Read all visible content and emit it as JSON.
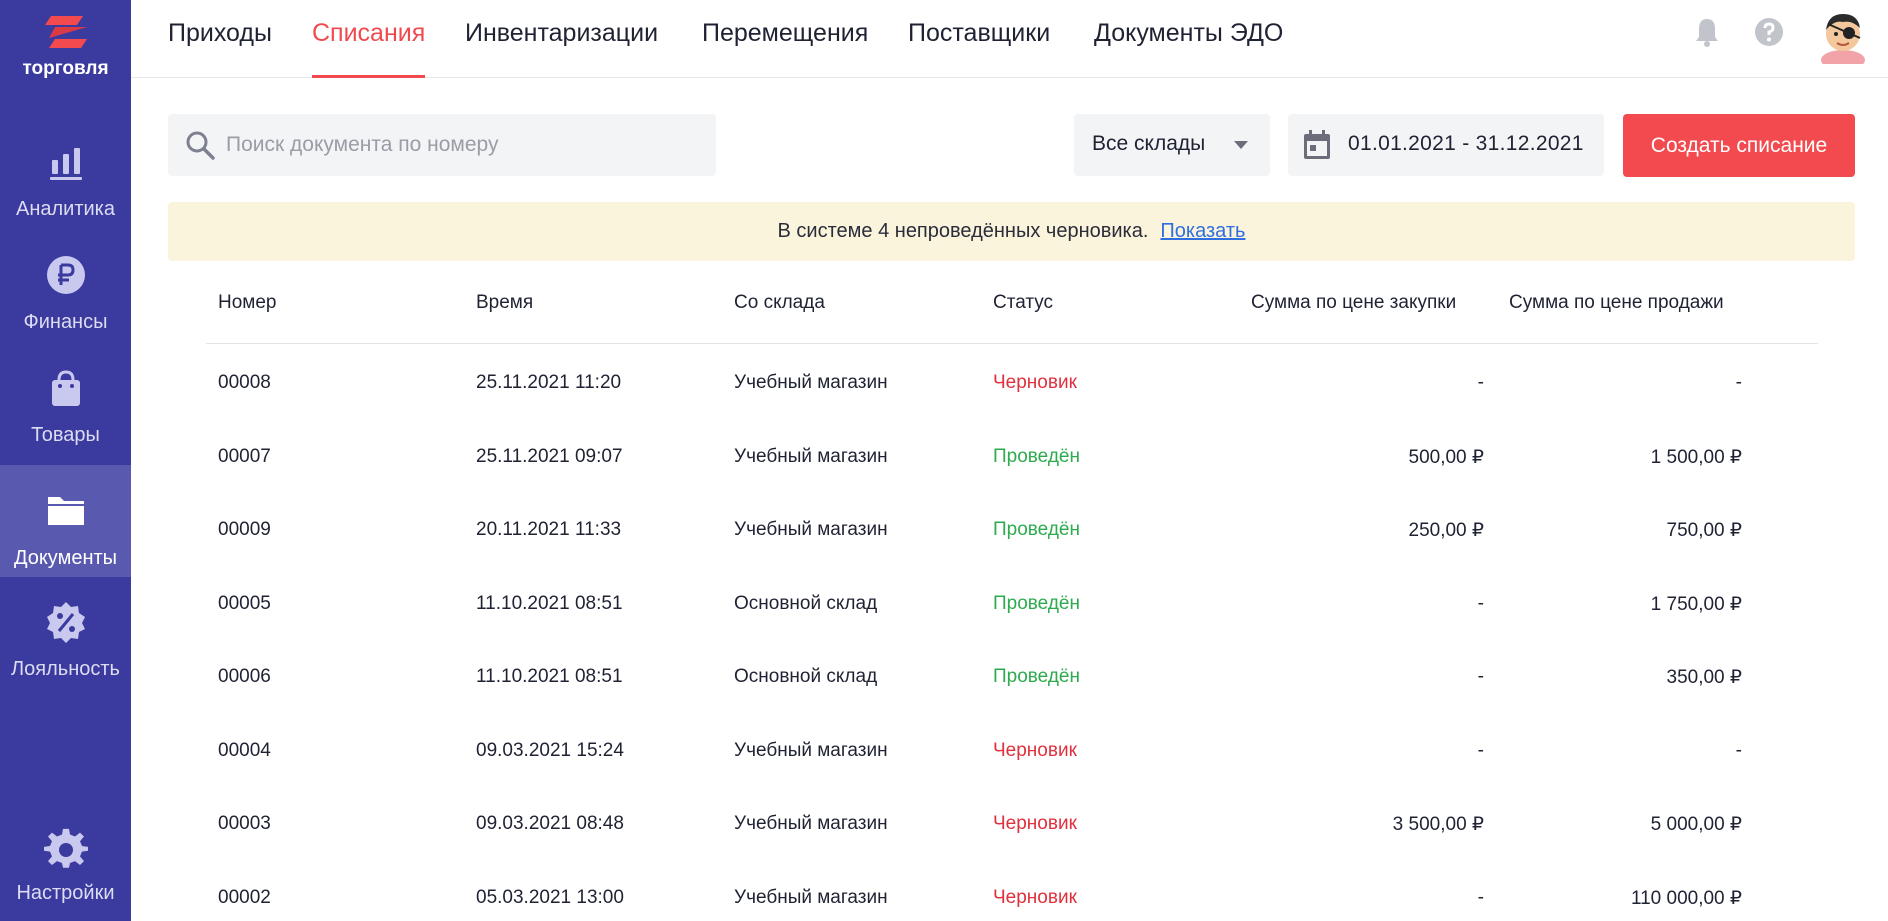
{
  "app": {
    "logo_text": "торговля"
  },
  "sidebar": {
    "items": [
      {
        "label": "Аналитика",
        "icon": "chart-bars-icon"
      },
      {
        "label": "Финансы",
        "icon": "ruble-icon"
      },
      {
        "label": "Товары",
        "icon": "shopping-bag-icon"
      },
      {
        "label": "Документы",
        "icon": "folder-icon",
        "active": true
      },
      {
        "label": "Лояльность",
        "icon": "discount-badge-icon"
      },
      {
        "label": "Настройки",
        "icon": "gear-icon"
      }
    ]
  },
  "tabs": [
    {
      "label": "Приходы"
    },
    {
      "label": "Списания",
      "active": true
    },
    {
      "label": "Инвентаризации"
    },
    {
      "label": "Перемещения"
    },
    {
      "label": "Поставщики"
    },
    {
      "label": "Документы ЭДО"
    }
  ],
  "toolbar": {
    "search_placeholder": "Поиск документа по номеру",
    "search_value": "",
    "warehouse_select": "Все склады",
    "date_range": "01.01.2021  -  31.12.2021",
    "create_label": "Создать списание"
  },
  "banner": {
    "text": "В системе 4 непроведённых черновика.",
    "link": "Показать"
  },
  "table": {
    "columns": [
      "Номер",
      "Время",
      "Со склада",
      "Статус",
      "Сумма по цене закупки",
      "Сумма по цене продажи"
    ],
    "rows": [
      {
        "number": "00008",
        "time": "25.11.2021 11:20",
        "warehouse": "Учебный магазин",
        "status": "Черновик",
        "status_kind": "draft",
        "purchase": "-",
        "sale": "-"
      },
      {
        "number": "00007",
        "time": "25.11.2021 09:07",
        "warehouse": "Учебный магазин",
        "status": "Проведён",
        "status_kind": "done",
        "purchase": "500,00 ₽",
        "sale": "1 500,00 ₽"
      },
      {
        "number": "00009",
        "time": "20.11.2021 11:33",
        "warehouse": "Учебный магазин",
        "status": "Проведён",
        "status_kind": "done",
        "purchase": "250,00 ₽",
        "sale": "750,00 ₽"
      },
      {
        "number": "00005",
        "time": "11.10.2021 08:51",
        "warehouse": "Основной склад",
        "status": "Проведён",
        "status_kind": "done",
        "purchase": "-",
        "sale": "1 750,00 ₽"
      },
      {
        "number": "00006",
        "time": "11.10.2021 08:51",
        "warehouse": "Основной склад",
        "status": "Проведён",
        "status_kind": "done",
        "purchase": "-",
        "sale": "350,00 ₽"
      },
      {
        "number": "00004",
        "time": "09.03.2021 15:24",
        "warehouse": "Учебный магазин",
        "status": "Черновик",
        "status_kind": "draft",
        "purchase": "-",
        "sale": "-"
      },
      {
        "number": "00003",
        "time": "09.03.2021 08:48",
        "warehouse": "Учебный магазин",
        "status": "Черновик",
        "status_kind": "draft",
        "purchase": "3 500,00 ₽",
        "sale": "5 000,00 ₽"
      },
      {
        "number": "00002",
        "time": "05.03.2021 13:00",
        "warehouse": "Учебный магазин",
        "status": "Черновик",
        "status_kind": "draft",
        "purchase": "-",
        "sale": "110 000,00 ₽"
      }
    ]
  },
  "colors": {
    "sidebar_bg": "#3b3a9e",
    "accent": "#f04a50",
    "status_draft": "#e0303d",
    "status_done": "#2eab4f",
    "banner_bg": "#fbf4dc",
    "link": "#2f6ee0"
  }
}
